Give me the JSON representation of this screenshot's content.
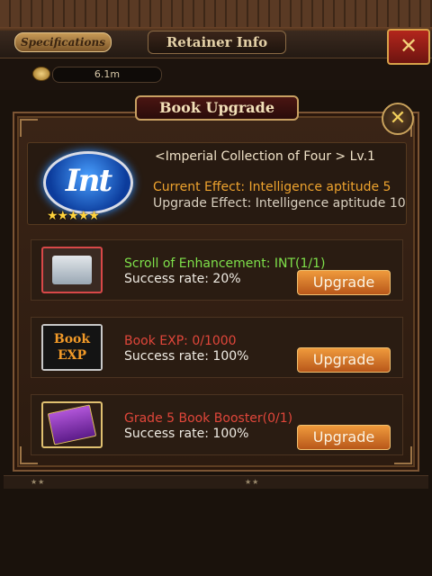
{
  "header": {
    "specifications_label": "Specifications",
    "title": "Retainer Info",
    "close_label": "✕"
  },
  "currency": {
    "amount": "6.1m"
  },
  "background_rows": [
    {
      "stars": "★★"
    },
    {
      "stars": "★★"
    }
  ],
  "dialog": {
    "title": "Book Upgrade",
    "close_label": "✕",
    "book": {
      "icon_text": "Int",
      "stars": "★★★★★",
      "name": "<Imperial Collection of Four > Lv.1",
      "current_effect": "Current Effect: Intelligence aptitude 5",
      "upgrade_effect": "Upgrade Effect: Intelligence aptitude 10"
    },
    "items": [
      {
        "name": "Scroll of Enhancement: INT(1/1)",
        "name_color": "#7ee04a",
        "rate": "Success rate: 20%",
        "button": "Upgrade"
      },
      {
        "name": "Book EXP: 0/1000",
        "name_color": "#e0463a",
        "rate": "Success rate: 100%",
        "button": "Upgrade",
        "icon_text": "Book EXP"
      },
      {
        "name": "Grade 5 Book Booster(0/1)",
        "name_color": "#e0463a",
        "rate": "Success rate: 100%",
        "button": "Upgrade"
      }
    ]
  },
  "colors": {
    "upgrade_button": "#e2832e",
    "current_effect": "#eea32e",
    "success_green": "#7ee04a",
    "insufficient_red": "#e0463a"
  }
}
